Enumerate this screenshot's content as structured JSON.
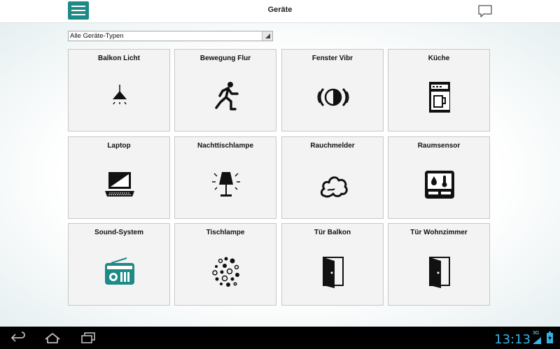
{
  "header": {
    "title": "Geräte"
  },
  "filter": {
    "selected": "Alle Geräte-Typen"
  },
  "devices": [
    {
      "label": "Balkon Licht",
      "icon": "ceiling-lamp-icon"
    },
    {
      "label": "Bewegung Flur",
      "icon": "running-person-icon"
    },
    {
      "label": "Fenster Vibr",
      "icon": "vibration-icon"
    },
    {
      "label": "Küche",
      "icon": "coffee-machine-icon"
    },
    {
      "label": "Laptop",
      "icon": "laptop-icon"
    },
    {
      "label": "Nachttischlampe",
      "icon": "table-lamp-icon"
    },
    {
      "label": "Rauchmelder",
      "icon": "smoke-icon"
    },
    {
      "label": "Raumsensor",
      "icon": "room-sensor-icon"
    },
    {
      "label": "Sound-System",
      "icon": "radio-icon"
    },
    {
      "label": "Tischlampe",
      "icon": "light-dots-icon"
    },
    {
      "label": "Tür Balkon",
      "icon": "open-door-icon"
    },
    {
      "label": "Tür Wohnzimmer",
      "icon": "open-door-icon"
    }
  ],
  "status_bar": {
    "time": "13:13",
    "network": "3G"
  },
  "colors": {
    "accent": "#1d8a87",
    "clock": "#33b5e5"
  }
}
